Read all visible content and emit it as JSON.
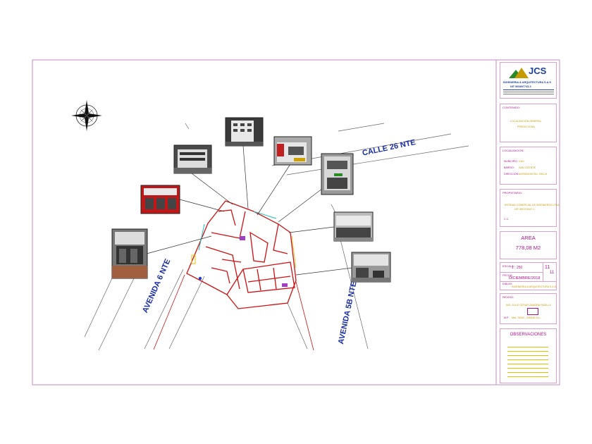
{
  "colors": {
    "frame": "#d39bd0",
    "plan_lines": "#d01010",
    "street_text": "#1a2ea8",
    "titleblock_text": "#b01090",
    "titleblock_value": "#c59a00"
  },
  "icons": [
    "compass-rose-icon",
    "company-logo-icon"
  ],
  "streets": {
    "calle": "CALLE 26 NTE",
    "avenida6": "AVENIDA 6 NTE",
    "avenida5b": "AVENIDA 5B NTE"
  },
  "titleblock": {
    "logo": {
      "brand": "JCS",
      "company": "INGENIERIA & ARQUITECTURA S.A.S",
      "nit": "NIT 900897743-3"
    },
    "contenido_label": "CONTENIDO:",
    "contenido_value": [
      "LOCALIZACION GENERAL",
      "PREDIO CENA"
    ],
    "localizacion_label": "LOCALIZACION:",
    "municipio_label": "MUNICIPIO:",
    "municipio_value": "CALI",
    "barrio_label": "BARRIO:",
    "barrio_value": "SAN VICENTE",
    "direccion_label": "DIRECCION:",
    "direccion_value": "AVENIDA 6N No. 25N-14",
    "propietario_label": "PROPIETARIO:",
    "propietario_value": "ENTIDAD COMERCIAL DE INGENIEROS LTDA",
    "propietario_nit": "NIT: 800721547-1",
    "cc_label": "C.C.",
    "area_label": "AREA",
    "area_value": "778,08  M2",
    "escala_label": "ESCALA:",
    "escala_value": "1 : 250",
    "fecha_label": "FECHA:",
    "fecha_value": "DICIEMBRE/2018",
    "sheet_num": "11",
    "sheet_total": "11",
    "dibujo_label": "DIBUJO:",
    "dibujo_value": "INGENIERIA & ARQUITECTURA S.A.S",
    "revisor_label": "REVISO:",
    "revisor_value": "ING. JULIO CESAR ZAMORA PADILLA",
    "revisor_mat_label": "M.P.",
    "revisor_mat_value": "Mat. 76202 - 336545 VLL",
    "observaciones_label": "OBSERVACIONES"
  }
}
